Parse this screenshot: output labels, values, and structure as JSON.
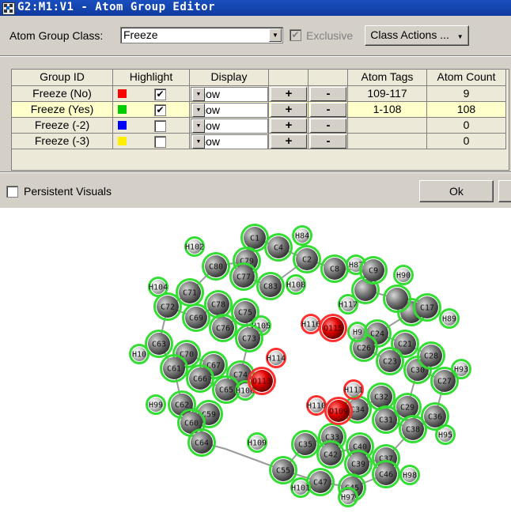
{
  "window": {
    "title": "G2:M1:V1 - Atom Group Editor"
  },
  "toolbar": {
    "class_label": "Atom Group Class:",
    "class_value": "Freeze",
    "exclusive_label": "Exclusive",
    "class_actions_label": "Class Actions ...",
    "class_actions_arrow": "▼"
  },
  "table": {
    "headers": [
      "Group ID",
      "Highlight",
      "Display",
      "",
      "",
      "Atom Tags",
      "Atom Count"
    ],
    "rows": [
      {
        "group_id": "Freeze (No)",
        "color": "#ff0000",
        "checked": "✔",
        "display": "Show",
        "plus": "+",
        "minus": "-",
        "atom_tags": "109-117",
        "atom_count": "9"
      },
      {
        "group_id": "Freeze (Yes)",
        "color": "#00cc00",
        "checked": "✔",
        "display": "Show",
        "plus": "+",
        "minus": "-",
        "atom_tags": "1-108",
        "atom_count": "108"
      },
      {
        "group_id": "Freeze (-2)",
        "color": "#0000ff",
        "checked": "",
        "display": "Show",
        "plus": "+",
        "minus": "-",
        "atom_tags": "",
        "atom_count": "0"
      },
      {
        "group_id": "Freeze (-3)",
        "color": "#ffee00",
        "checked": "",
        "display": "Show",
        "plus": "+",
        "minus": "-",
        "atom_tags": "",
        "atom_count": "0"
      }
    ]
  },
  "footer": {
    "persistent_label": "Persistent Visuals",
    "ok_label": "Ok"
  },
  "molecule": {
    "green_atoms": [
      "C1",
      "H84",
      "H102",
      "C4",
      "C2",
      "C80",
      "C79",
      "C8",
      "H87",
      "C9",
      "H90",
      "C77",
      "C83",
      "H108",
      "H104",
      "C71",
      "C78",
      "C72",
      "C69",
      "C75",
      "H105",
      "C76",
      "C73",
      "C63",
      "C70",
      "H10",
      "C67",
      "C61",
      "C74",
      "C66",
      "C65",
      "H106",
      "H99",
      "C62",
      "C59",
      "C60",
      "C64",
      "H109",
      "C35",
      "C33",
      "C42",
      "C40",
      "C39",
      "C37",
      "C55",
      "C47",
      "C45",
      "H101",
      "H97",
      "C46",
      "H98",
      "H117",
      "C17",
      "H89",
      "C24",
      "C21",
      "C26",
      "C23",
      "C30",
      "C28",
      "H93",
      "C27",
      "C32",
      "C34",
      "C31",
      "C29",
      "C38",
      "C36",
      "H95",
      "H9"
    ],
    "red_atoms": [
      "H116",
      "O115",
      "H114",
      "O113",
      "H111",
      "H110",
      "O109"
    ]
  }
}
